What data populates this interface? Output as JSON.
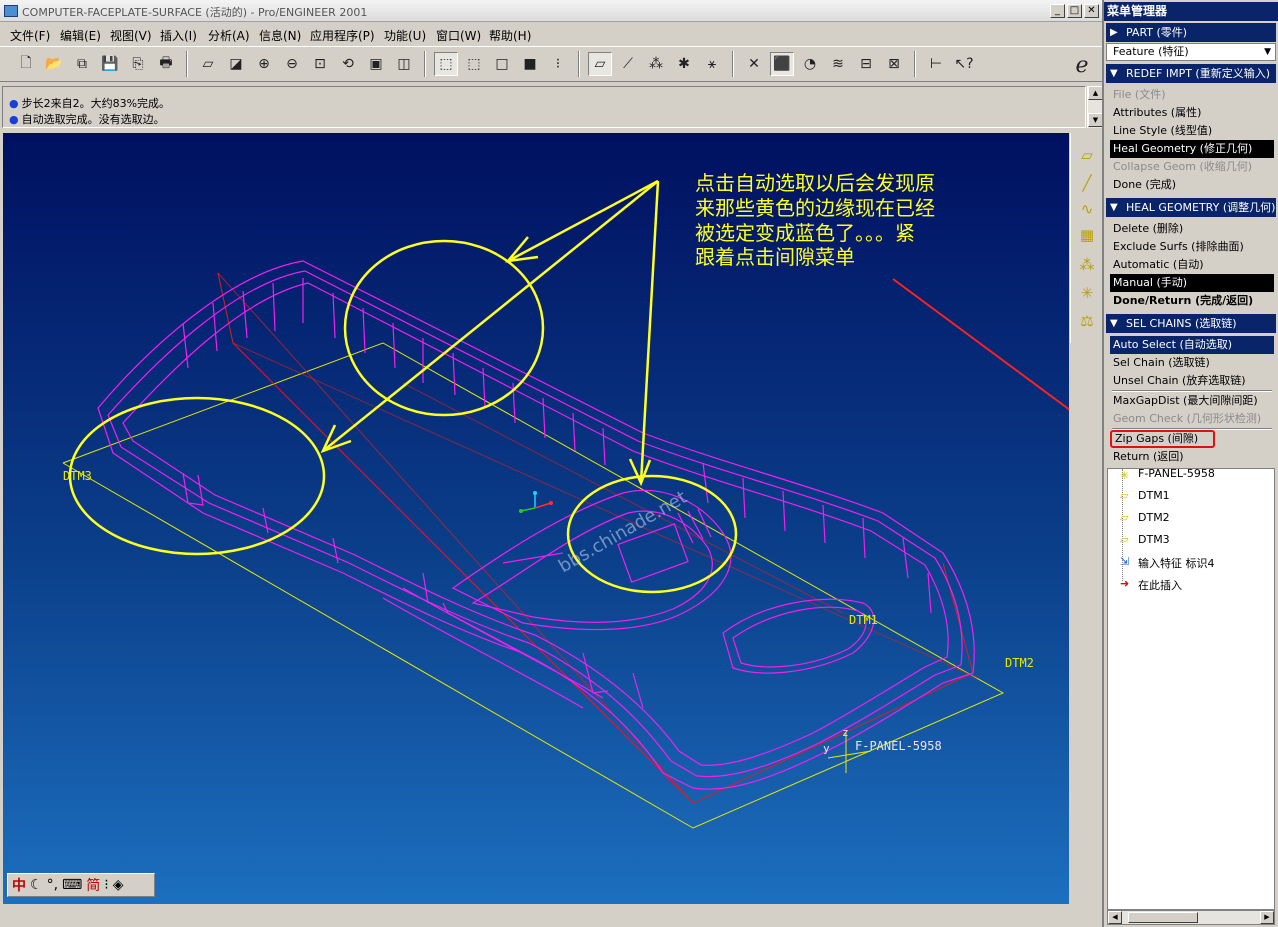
{
  "window": {
    "title": "COMPUTER-FACEPLATE-SURFACE (活动的) - Pro/ENGINEER 2001",
    "minimize": "_",
    "maximize": "□",
    "close": "✕"
  },
  "menubar": [
    "文件(F)",
    "编辑(E)",
    "视图(V)",
    "插入(I)",
    "分析(A)",
    "信息(N)",
    "应用程序(P)",
    "功能(U)",
    "窗口(W)",
    "帮助(H)"
  ],
  "messages": [
    "步长2来自2。大约83%完成。",
    "自动选取完成。没有选取边。"
  ],
  "annotation": {
    "lines": [
      "点击自动选取以后会发现原",
      "来那些黄色的边缘现在已经",
      "被选定变成蓝色了。。。紧",
      "跟着点击间隙菜单"
    ],
    "color": "#ffff00"
  },
  "watermark": "bbs.chinade.net",
  "viewport_labels": {
    "dtm3": "DTM3",
    "dtm1": "DTM1",
    "dtm2": "DTM2",
    "csys": "F-PANEL-5958",
    "axis_y": "y",
    "axis_z": "z"
  },
  "ime": {
    "lang": "中",
    "mode": "简"
  },
  "menu_manager": {
    "title": "菜单管理器",
    "part_header": "PART (零件)",
    "feature_select": "Feature (特征)",
    "redef_header": "REDEF IMPT (重新定义输入)",
    "redef_items": [
      {
        "label": "File (文件)",
        "state": "disabled"
      },
      {
        "label": "Attributes (属性)",
        "state": "normal"
      },
      {
        "label": "Line Style (线型值)",
        "state": "normal"
      },
      {
        "label": "Heal Geometry (修正几何)",
        "state": "selected"
      },
      {
        "label": "Collapse Geom (收缩几何)",
        "state": "disabled"
      },
      {
        "label": "Done (完成)",
        "state": "normal"
      }
    ],
    "heal_header": "HEAL GEOMETRY (调整几何)",
    "heal_items": [
      {
        "label": "Delete (删除)",
        "state": "normal"
      },
      {
        "label": "Exclude Surfs (排除曲面)",
        "state": "normal"
      },
      {
        "label": "Automatic (自动)",
        "state": "normal"
      },
      {
        "label": "Manual (手动)",
        "state": "selected"
      },
      {
        "label": "Done/Return (完成/返回)",
        "state": "bold"
      }
    ],
    "chains_header": "SEL CHAINS (选取链)",
    "chains_items": [
      {
        "label": "Auto Select (自动选取)",
        "state": "highlighted"
      },
      {
        "label": "Sel Chain (选取链)",
        "state": "normal"
      },
      {
        "label": "Unsel Chain (放弃选取链)",
        "state": "normal"
      },
      {
        "label": "MaxGapDist (最大间隙间距)",
        "state": "normal"
      },
      {
        "label": "Geom Check (几何形状检测)",
        "state": "disabled"
      },
      {
        "label": "Zip Gaps (间隙)",
        "state": "boxed"
      },
      {
        "label": "Return (返回)",
        "state": "normal"
      }
    ]
  },
  "model_tree": [
    {
      "label": "F-PANEL-5958",
      "icon": "csys-icon"
    },
    {
      "label": "DTM1",
      "icon": "datum-plane-icon"
    },
    {
      "label": "DTM2",
      "icon": "datum-plane-icon"
    },
    {
      "label": "DTM3",
      "icon": "datum-plane-icon"
    },
    {
      "label": "输入特征 标识4",
      "icon": "import-feature-icon"
    },
    {
      "label": "在此插入",
      "icon": "insert-here-arrow-icon"
    }
  ]
}
